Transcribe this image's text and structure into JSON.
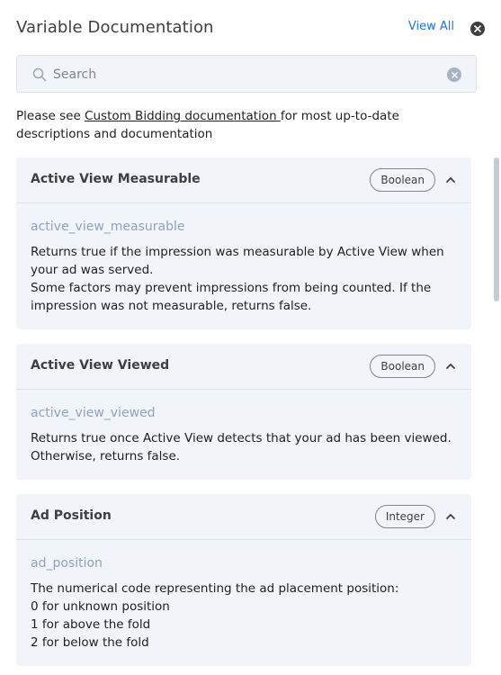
{
  "header": {
    "title": "Variable Documentation",
    "view_all_label": "View All"
  },
  "search": {
    "placeholder": "Search",
    "value": ""
  },
  "intro": {
    "prefix": "Please see ",
    "link_text": "Custom Bidding documentation ",
    "suffix": "for most up-to-date descriptions and documentation"
  },
  "cards": [
    {
      "title": "Active View Measurable",
      "type": "Boolean",
      "variable": "active_view_measurable",
      "description": "Returns true if the impression was measurable by Active View when your ad was served.\n Some factors may prevent impressions from being counted. If the impression was not measurable, returns false."
    },
    {
      "title": "Active View Viewed",
      "type": "Boolean",
      "variable": "active_view_viewed",
      "description": "Returns true once Active View detects that your ad has been viewed. Otherwise, returns false."
    },
    {
      "title": "Ad Position",
      "type": "Integer",
      "variable": "ad_position",
      "description": "The numerical code representing the ad placement position:\n 0 for unknown position\n1 for above the fold\n2 for below the fold"
    }
  ],
  "colors": {
    "link": "#1a73e8",
    "card_bg": "#f1f4f9",
    "variable_text": "#8fa3bf"
  }
}
